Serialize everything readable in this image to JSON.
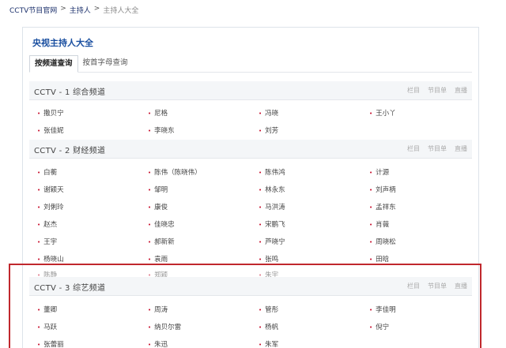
{
  "breadcrumb": {
    "items": [
      "CCTV节目官网",
      "主持人",
      "主持人大全"
    ],
    "separator": ">"
  },
  "panel": {
    "title": "央视主持人大全",
    "tabs": [
      {
        "label": "按频道查询",
        "active": true
      },
      {
        "label": "按首字母查询",
        "active": false
      }
    ]
  },
  "sections": [
    {
      "title": "CCTV - 1 综合频道",
      "links": [
        "栏目",
        "节目单",
        "直播"
      ],
      "hosts": [
        [
          "撒贝宁",
          "尼格",
          "冯晓",
          "王小丫"
        ],
        [
          "张佳妮",
          "李晓东",
          "刘芳"
        ]
      ]
    },
    {
      "title": "CCTV - 2 财经频道",
      "links": [
        "栏目",
        "节目单",
        "直播"
      ],
      "hosts": [
        [
          "白蘅",
          "陈伟（陈晓伟）",
          "陈伟鸿",
          "计源"
        ],
        [
          "谢颖天",
          "邹明",
          "林永东",
          "刘声柄"
        ],
        [
          "刘俐玲",
          "康俊",
          "马洪涛",
          "孟祥东"
        ],
        [
          "赵杰",
          "佳晓忠",
          "宋鹏飞",
          "肖薇"
        ],
        [
          "王宇",
          "郝新新",
          "芦晓宁",
          "周晓松"
        ],
        [
          "杨晓山",
          "袁雨",
          "张鸣",
          "田晗"
        ],
        [
          "陈静",
          "郑颖",
          "朱宇"
        ]
      ]
    },
    {
      "title": "CCTV - 3 综艺频道",
      "links": [
        "栏目",
        "节目单",
        "直播"
      ],
      "hosts": [
        [
          "董卿",
          "周涛",
          "管彤",
          "李佳明"
        ],
        [
          "马跃",
          "纳贝尔雷",
          "杨帆",
          "倪宁"
        ],
        [
          "张蕾丽",
          "朱迅",
          "朱军"
        ]
      ]
    }
  ],
  "colors": {
    "accent": "#1a4fa0",
    "bullet": "#c8102e",
    "highlight_border": "#c0282d"
  }
}
